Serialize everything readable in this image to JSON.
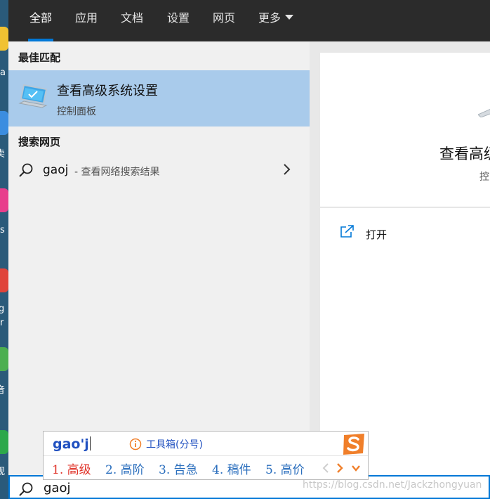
{
  "tabs": [
    {
      "label": "全部",
      "active": true
    },
    {
      "label": "应用"
    },
    {
      "label": "文档"
    },
    {
      "label": "设置"
    },
    {
      "label": "网页"
    },
    {
      "label": "更多"
    }
  ],
  "desktop_fragments": [
    "a",
    "卖",
    "os",
    "g",
    "or",
    "音",
    "视"
  ],
  "best_match": {
    "header": "最佳匹配",
    "title": "查看高级系统设置",
    "subtitle": "控制面板",
    "icon": "computer-settings-icon"
  },
  "web_search": {
    "header": "搜索网页",
    "query": "gaoj",
    "suffix": "- 查看网络搜索结果",
    "icon": "search-icon"
  },
  "preview": {
    "title": "查看高级",
    "subtitle": "控",
    "open_label": "打开",
    "open_icon": "open-window-icon"
  },
  "search_box": {
    "value": "gaoj",
    "icon": "search-icon"
  },
  "ime": {
    "composition": "gao'j",
    "toolbox": "工具箱(分号)",
    "candidates": [
      "1. 高级",
      "2. 高阶",
      "3. 告急",
      "4. 稿件",
      "5. 高价"
    ],
    "logo": "sogou-logo-icon"
  },
  "watermark": "https://blog.csdn.net/Jackzhongyuan",
  "colors": {
    "accent": "#0078d7",
    "selection": "#a9cbeb",
    "ime_first_candidate": "#e0342a",
    "ime_candidate": "#2a6ebd",
    "sogou_orange": "#f07f2a"
  }
}
